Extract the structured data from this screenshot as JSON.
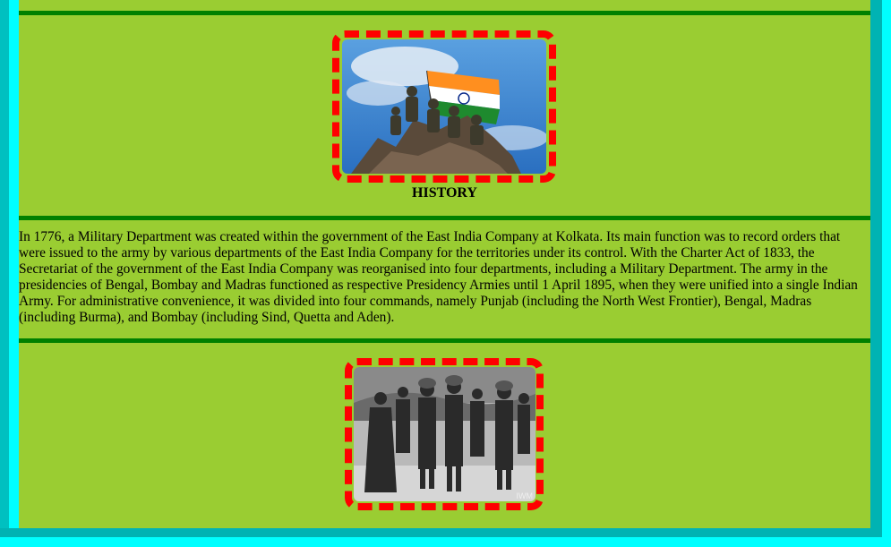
{
  "sections": [
    {
      "image": {
        "alt_icon": "flag-summit-photo-icon"
      },
      "caption": "HISTORY"
    },
    {
      "paragraph": "In 1776, a Military Department was created within the government of the East India Company at Kolkata. Its main function was to record orders that were issued to the army by various departments of the East India Company for the territories under its control. With the Charter Act of 1833, the Secretariat of the government of the East India Company was reorganised into four departments, including a Military Department. The army in the presidencies of Bengal, Bombay and Madras functioned as respective Presidency Armies until 1 April 1895, when they were unified into a single Indian Army. For administrative convenience, it was divided into four commands, namely Punjab (including the North West Frontier), Bengal, Madras (including Burma), and Bombay (including Sind, Quetta and Aden)."
    },
    {
      "image": {
        "alt_icon": "historic-soldiers-photo-icon",
        "watermark": "IWM"
      }
    }
  ],
  "colors": {
    "background": "#9acd32",
    "rule": "#008000",
    "image_border": "#ff0000",
    "frame_outer": "#00ffff",
    "frame_inner": "#00b3b3"
  }
}
